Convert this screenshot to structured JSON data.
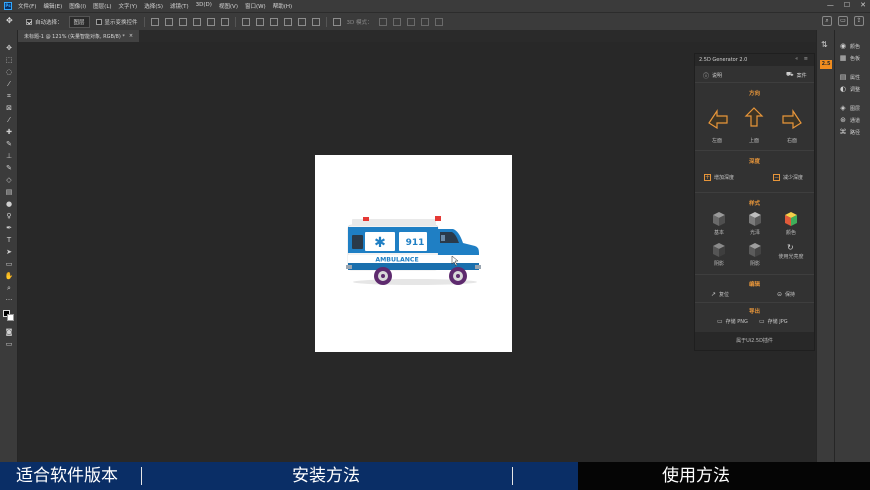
{
  "menubar": {
    "app_icon": "Ps",
    "items": [
      "文件(F)",
      "编辑(E)",
      "图像(I)",
      "图层(L)",
      "文字(Y)",
      "选择(S)",
      "滤镜(T)",
      "3D(D)",
      "视图(V)",
      "窗口(W)",
      "帮助(H)"
    ],
    "window_controls": [
      "—",
      "☐",
      "✕"
    ]
  },
  "optionsbar": {
    "auto_select_label": "自动选择：",
    "auto_select_checked": true,
    "auto_select_target": "图层",
    "show_transform_label": "显示变换控件",
    "show_transform_checked": false,
    "mode_label": "3D 模式："
  },
  "document_tab": {
    "title": "未标题-1 @ 121% (矢量智能对象, RGB/8) *",
    "close": "×"
  },
  "panel": {
    "title": "2.5D Generator 2.0",
    "help_label": "说明",
    "shop_label": "案件",
    "sections": {
      "direction": "方向",
      "depth": "深度",
      "style": "样式",
      "edit": "编辑",
      "export": "导出"
    },
    "direction_buttons": [
      "左面",
      "上面",
      "右面"
    ],
    "depth_buttons": [
      "增加深度",
      "减少深度"
    ],
    "style_buttons": [
      "基本",
      "光泽",
      "颜色",
      "阴影",
      "阴影",
      "使用光亮度"
    ],
    "edit_buttons": [
      "复位",
      "保持"
    ],
    "export_buttons": [
      "存储 PNG",
      "存储 JPG"
    ],
    "footer": "属于Ui2.5D插件"
  },
  "right_strip": {
    "badge": "2.5",
    "items": [
      "颜色",
      "色板",
      "属性",
      "调整",
      "图层",
      "通道",
      "路径"
    ]
  },
  "banner": {
    "item1": "适合软件版本",
    "item2": "安装方法",
    "item3": "使用方法"
  },
  "canvas_art": {
    "vehicle_text": "AMBULANCE",
    "vehicle_number": "911"
  },
  "colors": {
    "accent_orange": "#e8963a",
    "banner_blue": "#0a2e66",
    "ambulance_blue": "#1f7fc4"
  }
}
